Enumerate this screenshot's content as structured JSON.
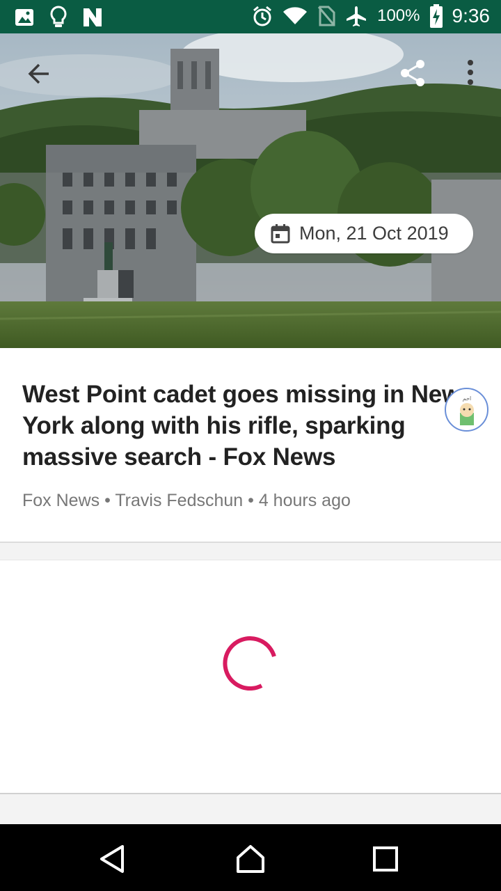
{
  "status_bar": {
    "battery_percent": "100%",
    "time": "9:36",
    "left_icons": [
      "gallery-icon",
      "lightbulb-icon",
      "n-notification-icon"
    ],
    "right_icons": [
      "alarm-icon",
      "wifi-icon",
      "no-sim-icon",
      "airplane-mode-icon",
      "battery-charging-icon"
    ]
  },
  "hero": {
    "date": "Mon, 21 Oct 2019"
  },
  "article": {
    "headline": "West Point cadet goes missing in New York along with his rifle, sparking massive search - Fox News",
    "meta": "Fox News • Travis Fedschun • 4 hours ago"
  },
  "nav_bar": {
    "buttons": [
      "back",
      "home",
      "recents"
    ]
  },
  "colors": {
    "status_bar": "#0a5c43",
    "spinner": "#d81b60",
    "avatar_ring": "#6a8fd8"
  }
}
